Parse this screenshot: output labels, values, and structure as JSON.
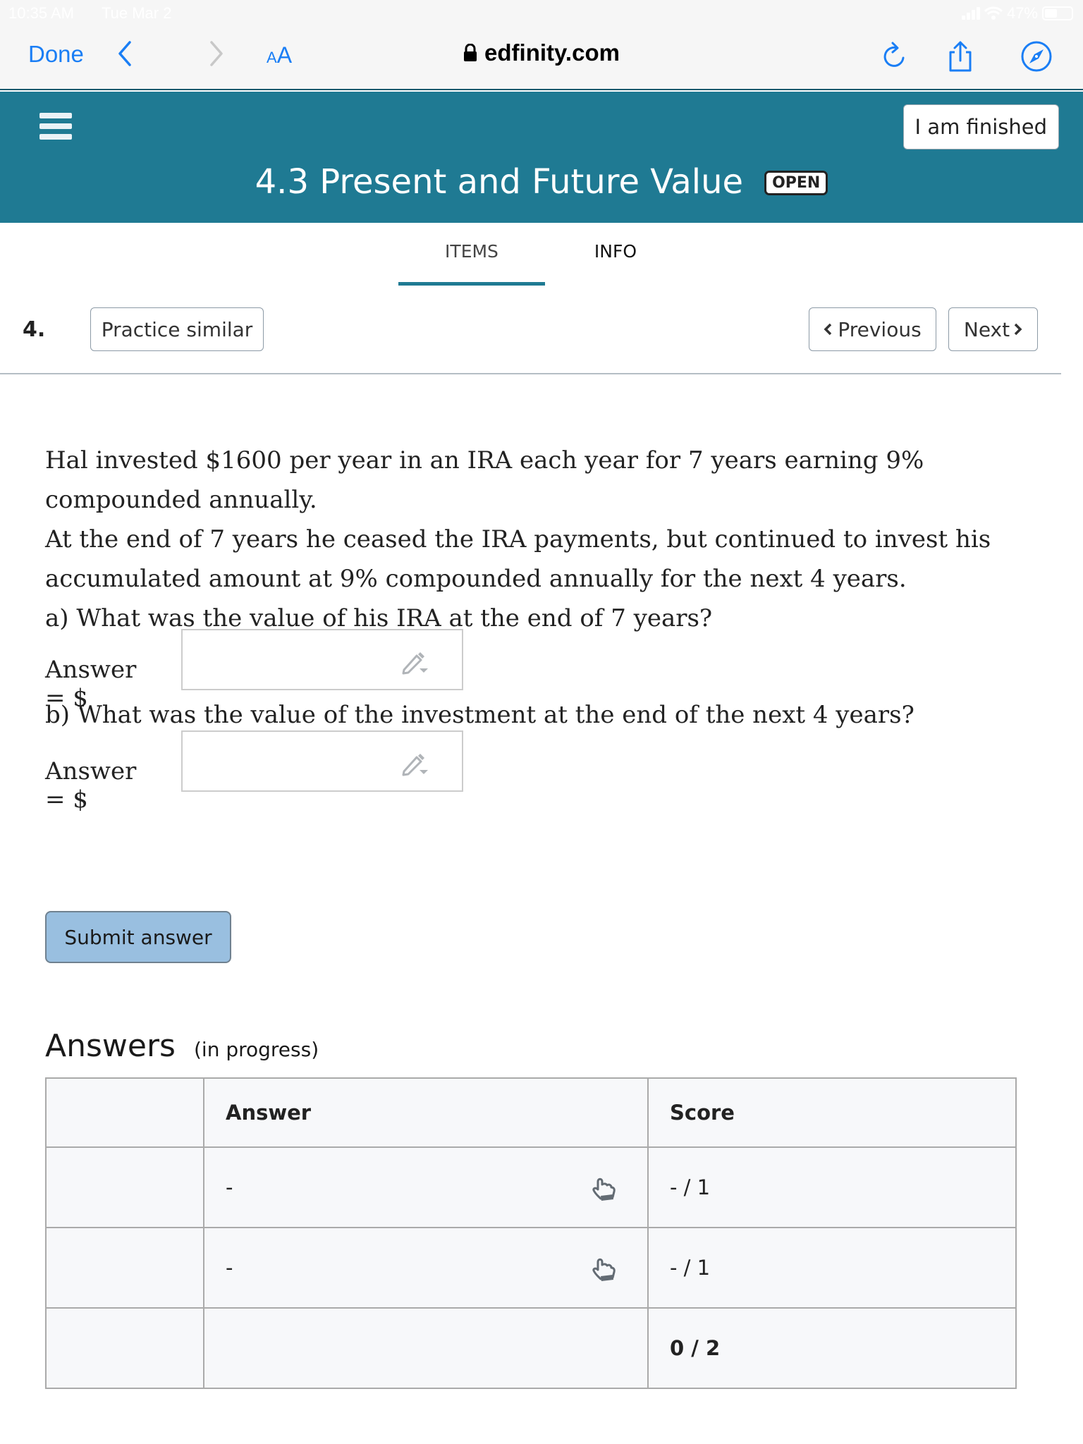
{
  "status_bar": {
    "time": "10:35 AM",
    "date": "Tue Mar 2",
    "battery_percent_label": "47%",
    "battery_level": 0.47
  },
  "browser": {
    "done_label": "Done",
    "text_size_small": "A",
    "text_size_large": "A",
    "url": "edfinity.com",
    "icons": [
      "back-chevron-icon",
      "forward-chevron-icon",
      "lock-icon",
      "reload-icon",
      "share-icon",
      "compass-icon"
    ]
  },
  "header": {
    "finished_label": "I am finished",
    "title": "4.3 Present and Future Value",
    "status_badge": "OPEN"
  },
  "tabs": [
    {
      "label": "ITEMS",
      "active": true
    },
    {
      "label": "INFO",
      "active": false
    }
  ],
  "question": {
    "number": "4.",
    "practice_label": "Practice similar",
    "previous_label": "Previous",
    "next_label": "Next",
    "paragraph1": "Hal invested $1600 per year in an IRA each year for 7 years earning 9% compounded annually.",
    "paragraph2": "At the end of 7 years he ceased the IRA payments, but continued to invest his accumulated amount at 9% compounded annually for the next 4 years.",
    "part_a": "a) What was the value of his IRA at the end of 7 years?",
    "part_b": "b) What was the value of the investment at the end of the next 4 years?",
    "answer_label": "Answer = $",
    "answer_a_value": "",
    "answer_b_value": "",
    "submit_label": "Submit answer"
  },
  "answers": {
    "heading": "Answers",
    "subheading": "(in progress)",
    "columns": [
      "",
      "Answer",
      "Score"
    ],
    "rows": [
      {
        "answer": "-",
        "score": "- / 1"
      },
      {
        "answer": "-",
        "score": "- / 1"
      }
    ],
    "total": "0 / 2"
  }
}
